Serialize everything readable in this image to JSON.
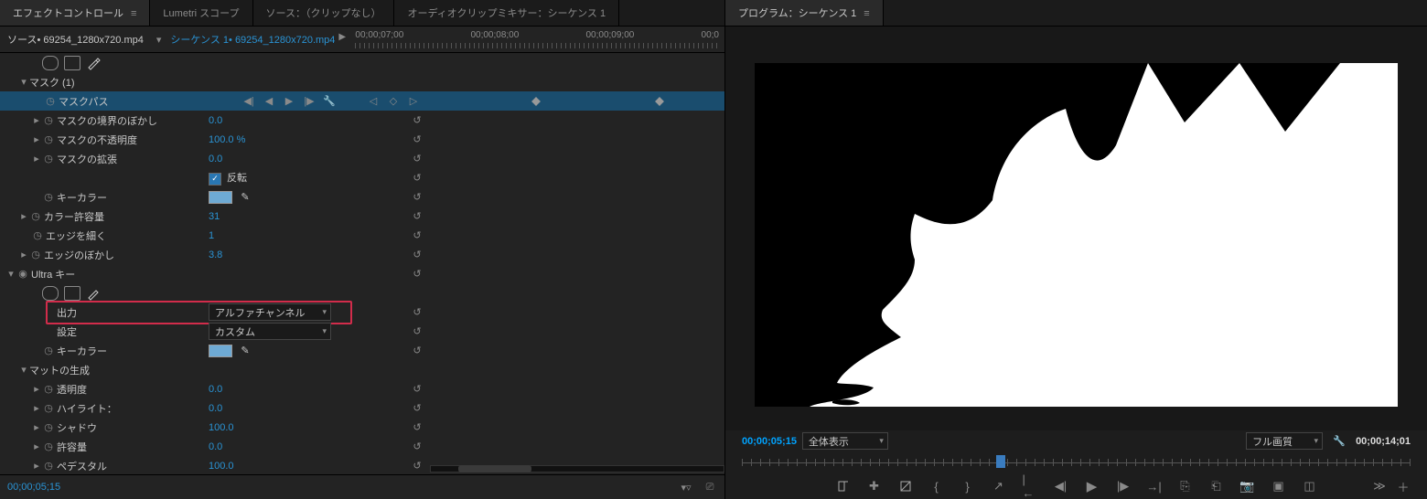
{
  "tabs": {
    "effect_controls": "エフェクトコントロール",
    "lumetri": "Lumetri スコープ",
    "source": "ソース：（クリップなし）",
    "audio_mixer": "オーディオクリップミキサー：シーケンス 1"
  },
  "source_bar": {
    "prefix": "ソース•",
    "clip": "69254_1280x720.mp4",
    "seq_prefix": "シーケンス  1•",
    "seq_clip": "69254_1280x720.mp4"
  },
  "ruler": {
    "t1": "00;00;07;00",
    "t2": "00;00;08;00",
    "t3": "00;00;09;00",
    "t4": "00;0"
  },
  "rows": {
    "mask_group": "マスク (1)",
    "mask_path": "マスクパス",
    "mask_feather": "マスクの境界のぼかし",
    "mask_feather_v": "0.0",
    "mask_opacity": "マスクの不透明度",
    "mask_opacity_v": "100.0 %",
    "mask_expand": "マスクの拡張",
    "mask_expand_v": "0.0",
    "invert": "反転",
    "key_color": "キーカラー",
    "color_tol": "カラー許容量",
    "color_tol_v": "31",
    "edge_thin": "エッジを細く",
    "edge_thin_v": "1",
    "edge_feather": "エッジのぼかし",
    "edge_feather_v": "3.8",
    "ultra_key": "Ultra キー",
    "output": "出力",
    "output_v": "アルファチャンネル",
    "setting": "設定",
    "setting_v": "カスタム",
    "key_color2": "キーカラー",
    "matte_gen": "マットの生成",
    "transparency": "透明度",
    "transparency_v": "0.0",
    "highlight": "ハイライト：",
    "highlight_v": "0.0",
    "shadow": "シャドウ",
    "shadow_v": "100.0",
    "tolerance": "許容量",
    "tolerance_v": "0.0",
    "pedestal": "ペデスタル",
    "pedestal_v": "100.0"
  },
  "left_bottom_tc": "00;00;05;15",
  "program": {
    "tab": "プログラム：シーケンス 1",
    "tc": "00;00;05;15",
    "fit": "全体表示",
    "quality": "フル画質",
    "duration": "00;00;14;01",
    "playhead_pct": 38
  }
}
